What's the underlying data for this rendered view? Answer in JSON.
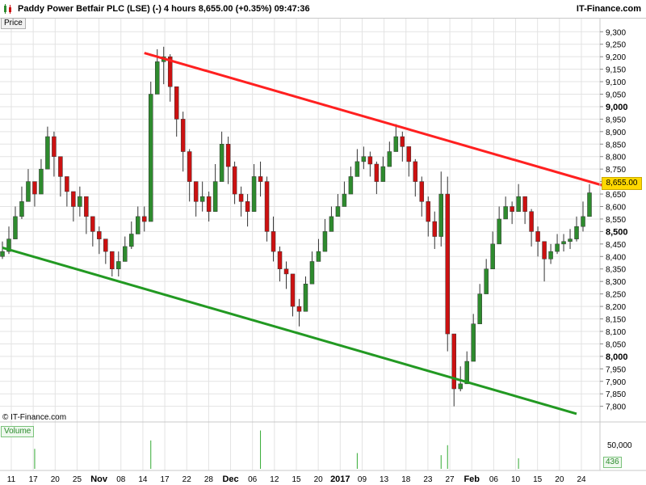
{
  "header": {
    "title": "Paddy Power Betfair PLC (LSE) (-)   4 hours    8,655.00 (+0.35%)    09:47:36",
    "brand": "IT-Finance.com"
  },
  "panels": {
    "price_label": "Price",
    "volume_label": "Volume",
    "copyright": "© IT-Finance.com",
    "last_price": "8,655.00",
    "volume_last": "436",
    "volume_axis_label": "50,000"
  },
  "colors": {
    "up": "#2e8b2e",
    "down": "#cc1111",
    "resistance": "#ff2020",
    "support": "#229922",
    "grid": "#e3e3e3"
  },
  "chart_data": {
    "type": "candlestick",
    "timeframe": "4 hours",
    "ylim": [
      7760,
      9330
    ],
    "y_ticks": [
      "9,300",
      "9,250",
      "9,200",
      "9,150",
      "9,100",
      "9,050",
      "9,000",
      "8,950",
      "8,900",
      "8,850",
      "8,800",
      "8,750",
      "8,700",
      "8,650",
      "8,600",
      "8,550",
      "8,500",
      "8,450",
      "8,400",
      "8,350",
      "8,300",
      "8,250",
      "8,200",
      "8,150",
      "8,100",
      "8,050",
      "8,000",
      "7,950",
      "7,900",
      "7,850",
      "7,800"
    ],
    "y_bold": [
      "9,000",
      "8,500",
      "8,000"
    ],
    "x_labels": [
      "11",
      "17",
      "20",
      "25",
      "Nov",
      "08",
      "14",
      "17",
      "22",
      "28",
      "Dec",
      "06",
      "12",
      "15",
      "20",
      "2017",
      "09",
      "13",
      "18",
      "23",
      "27",
      "Feb",
      "06",
      "10",
      "15",
      "20",
      "24"
    ],
    "x_bold": [
      "Nov",
      "Dec",
      "2017",
      "Feb"
    ],
    "series": [
      {
        "name": "Price",
        "close": [
          8420,
          8470,
          8560,
          8620,
          8700,
          8650,
          8750,
          8880,
          8800,
          8720,
          8660,
          8600,
          8640,
          8560,
          8500,
          8470,
          8420,
          8350,
          8380,
          8440,
          8490,
          8560,
          8540,
          9050,
          9180,
          9200,
          9080,
          8950,
          8820,
          8700,
          8620,
          8640,
          8580,
          8700,
          8850,
          8760,
          8650,
          8620,
          8580,
          8720,
          8700,
          8500,
          8420,
          8350,
          8330,
          8200,
          8180,
          8290,
          8380,
          8420,
          8500,
          8560,
          8600,
          8650,
          8720,
          8780,
          8800,
          8770,
          8700,
          8760,
          8820,
          8880,
          8840,
          8780,
          8700,
          8620,
          8540,
          8480,
          8650,
          8090,
          7870,
          7890,
          7980,
          8130,
          8250,
          8350,
          8450,
          8550,
          8600,
          8580,
          8640,
          8580,
          8500,
          8460,
          8390,
          8420,
          8450,
          8460,
          8470,
          8520,
          8560,
          8655
        ],
        "high": [
          8460,
          8520,
          8600,
          8680,
          8750,
          8700,
          8790,
          8920,
          8900,
          8790,
          8700,
          8650,
          8680,
          8620,
          8560,
          8520,
          8470,
          8400,
          8420,
          8480,
          8540,
          8600,
          8600,
          9100,
          9230,
          9240,
          9210,
          9080,
          8980,
          8830,
          8700,
          8700,
          8660,
          8770,
          8900,
          8880,
          8780,
          8680,
          8650,
          8770,
          8780,
          8720,
          8560,
          8440,
          8380,
          8320,
          8230,
          8320,
          8420,
          8470,
          8550,
          8600,
          8650,
          8700,
          8760,
          8830,
          8840,
          8820,
          8780,
          8800,
          8860,
          8930,
          8900,
          8840,
          8790,
          8720,
          8640,
          8580,
          8740,
          8720,
          8060,
          7960,
          8020,
          8170,
          8290,
          8390,
          8500,
          8600,
          8640,
          8620,
          8690,
          8640,
          8590,
          8520,
          8440,
          8450,
          8490,
          8490,
          8510,
          8560,
          8620,
          8690
        ],
        "low": [
          8390,
          8410,
          8500,
          8550,
          8640,
          8600,
          8690,
          8780,
          8720,
          8640,
          8600,
          8540,
          8560,
          8490,
          8440,
          8410,
          8370,
          8320,
          8320,
          8400,
          8430,
          8500,
          8500,
          8950,
          9060,
          9090,
          9020,
          8880,
          8740,
          8620,
          8560,
          8580,
          8540,
          8620,
          8720,
          8690,
          8610,
          8560,
          8520,
          8640,
          8640,
          8460,
          8380,
          8300,
          8270,
          8160,
          8120,
          8240,
          8310,
          8380,
          8440,
          8500,
          8560,
          8600,
          8680,
          8730,
          8750,
          8720,
          8650,
          8700,
          8770,
          8820,
          8780,
          8720,
          8640,
          8560,
          8480,
          8430,
          8440,
          8020,
          7800,
          7860,
          7930,
          8080,
          8190,
          8300,
          8400,
          8500,
          8550,
          8530,
          8580,
          8530,
          8440,
          8400,
          8300,
          8370,
          8410,
          8420,
          8430,
          8460,
          8500,
          8600
        ]
      }
    ],
    "volume": [
      {
        "bar": 5,
        "value": 38000
      },
      {
        "bar": 23,
        "value": 54000
      },
      {
        "bar": 40,
        "value": 73000
      },
      {
        "bar": 55,
        "value": 30000
      },
      {
        "bar": 68,
        "value": 26000
      },
      {
        "bar": 69,
        "value": 45000
      },
      {
        "bar": 80,
        "value": 20000
      }
    ],
    "resistance_line": {
      "from": {
        "bar": 22,
        "price": 9215
      },
      "to": {
        "bar": 93,
        "price": 8685
      },
      "color": "red"
    },
    "support_line": {
      "from": {
        "bar": 0,
        "price": 8435
      },
      "to": {
        "bar": 89,
        "price": 7770
      },
      "color": "green"
    }
  }
}
